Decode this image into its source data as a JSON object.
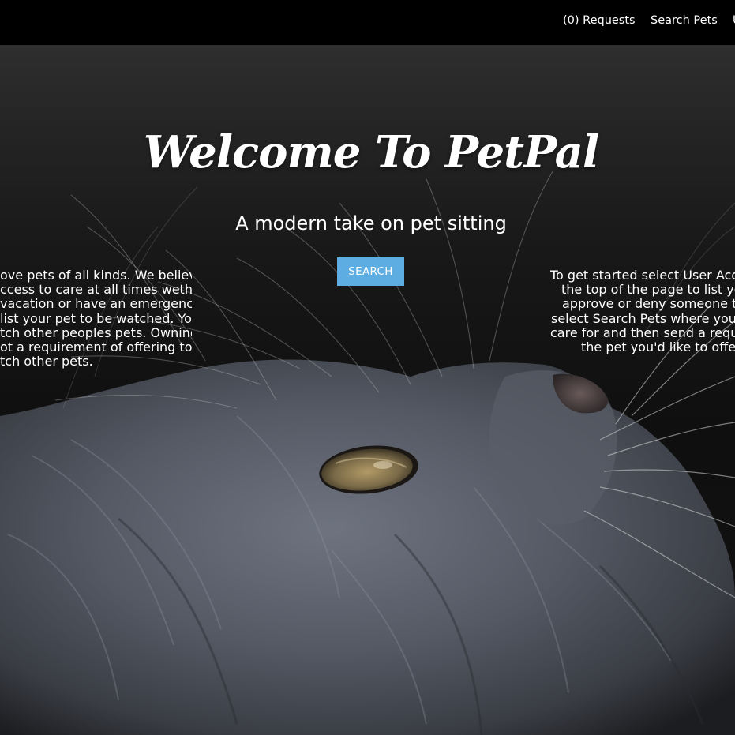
{
  "nav": {
    "requests_label": "(0) Requests",
    "search_pets_label": "Search Pets",
    "cut_label": "U"
  },
  "hero": {
    "title": "Welcome To PetPal",
    "subtitle": "A modern take on pet sitting",
    "search_button": "SEARCH",
    "intro_left_lines": [
      "ove pets of all kinds. We believe",
      "ccess to care at all times wether",
      "vacation or have an emergency.",
      "list your pet to be watched. You",
      "tch other peoples pets. Owning",
      "ot a requirement of offering to",
      "tch other pets."
    ],
    "intro_right_lines": [
      "To get started select User Acco",
      "the top of the page to list you",
      "approve or deny someone to",
      "select Search Pets where you c",
      "care for and then send a reque",
      "the pet you'd like to offer"
    ]
  },
  "colors": {
    "navbar_bg": "#000000",
    "button_bg": "#5dade2",
    "text": "#ffffff"
  }
}
